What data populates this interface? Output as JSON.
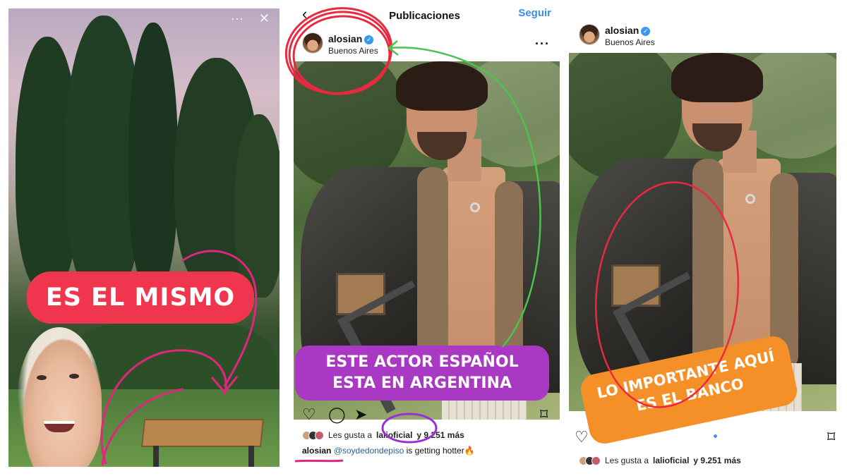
{
  "story": {
    "sticker_text": "ES EL MISMO",
    "sticker_color": "#f0364f"
  },
  "post_a": {
    "back_icon": "chevron-left-icon",
    "header_title": "Publicaciones",
    "follow_label": "Seguir",
    "username": "alosian",
    "location": "Buenos Aires",
    "likes_prefix": "Les gusta a",
    "likes_user": "lalioficial",
    "likes_suffix": "y 9.251 más",
    "caption_user": "alosian",
    "caption_mention": "@soydedondepiso",
    "caption_text": "is getting hotter🔥",
    "overlay_text": "ESTE ACTOR ESPAÑOL ESTA EN ARGENTINA",
    "overlay_color": "#a938c2"
  },
  "post_b": {
    "username": "alosian",
    "location": "Buenos Aires",
    "likes_prefix": "Les gusta a",
    "likes_user": "lalioficial",
    "likes_suffix": "y 9.251 más",
    "overlay_text": "LO IMPORTANTE AQUÍ ES EL BANCO",
    "overlay_color": "#f59028"
  },
  "colors": {
    "link_blue": "#3a8ee6",
    "verified_blue": "#3897f0",
    "annotation_red": "#e8293f",
    "annotation_pink": "#e0277f",
    "annotation_purple": "#9b2fd6",
    "annotation_green": "#4cc34c"
  },
  "icons": [
    "close-icon",
    "more-icon",
    "verified-icon",
    "heart-icon",
    "comment-icon",
    "share-icon",
    "bookmark-icon"
  ]
}
